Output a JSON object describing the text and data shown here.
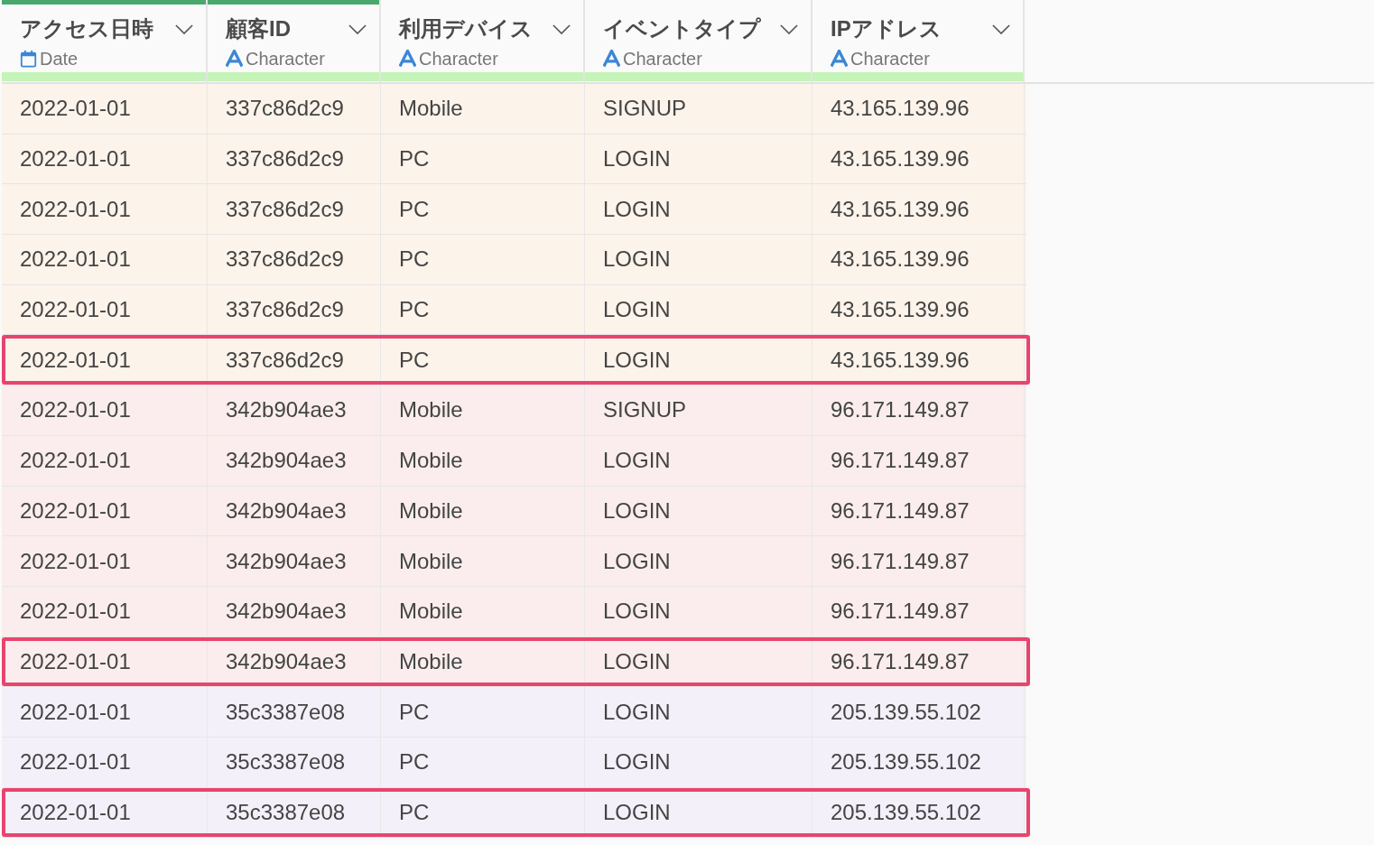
{
  "columns": [
    {
      "title": "アクセス日時",
      "type": "Date",
      "kind": "date",
      "selected": true
    },
    {
      "title": "顧客ID",
      "type": "Character",
      "kind": "character",
      "selected": true
    },
    {
      "title": "利用デバイス",
      "type": "Character",
      "kind": "character",
      "selected": false
    },
    {
      "title": "イベントタイプ",
      "type": "Character",
      "kind": "character",
      "selected": false
    },
    {
      "title": "IPアドレス",
      "type": "Character",
      "kind": "character",
      "selected": false
    }
  ],
  "rows": [
    {
      "color": "#fcf3ea",
      "highlighted": false,
      "cells": [
        "2022-01-01",
        "337c86d2c9",
        "Mobile",
        "SIGNUP",
        "43.165.139.96"
      ]
    },
    {
      "color": "#fcf3ea",
      "highlighted": false,
      "cells": [
        "2022-01-01",
        "337c86d2c9",
        "PC",
        "LOGIN",
        "43.165.139.96"
      ]
    },
    {
      "color": "#fcf3ea",
      "highlighted": false,
      "cells": [
        "2022-01-01",
        "337c86d2c9",
        "PC",
        "LOGIN",
        "43.165.139.96"
      ]
    },
    {
      "color": "#fcf3ea",
      "highlighted": false,
      "cells": [
        "2022-01-01",
        "337c86d2c9",
        "PC",
        "LOGIN",
        "43.165.139.96"
      ]
    },
    {
      "color": "#fcf3ea",
      "highlighted": false,
      "cells": [
        "2022-01-01",
        "337c86d2c9",
        "PC",
        "LOGIN",
        "43.165.139.96"
      ]
    },
    {
      "color": "#fcf3ea",
      "highlighted": true,
      "cells": [
        "2022-01-01",
        "337c86d2c9",
        "PC",
        "LOGIN",
        "43.165.139.96"
      ]
    },
    {
      "color": "#fbeded",
      "highlighted": false,
      "cells": [
        "2022-01-01",
        "342b904ae3",
        "Mobile",
        "SIGNUP",
        "96.171.149.87"
      ]
    },
    {
      "color": "#fbeded",
      "highlighted": false,
      "cells": [
        "2022-01-01",
        "342b904ae3",
        "Mobile",
        "LOGIN",
        "96.171.149.87"
      ]
    },
    {
      "color": "#fbeded",
      "highlighted": false,
      "cells": [
        "2022-01-01",
        "342b904ae3",
        "Mobile",
        "LOGIN",
        "96.171.149.87"
      ]
    },
    {
      "color": "#fbeded",
      "highlighted": false,
      "cells": [
        "2022-01-01",
        "342b904ae3",
        "Mobile",
        "LOGIN",
        "96.171.149.87"
      ]
    },
    {
      "color": "#fbeded",
      "highlighted": false,
      "cells": [
        "2022-01-01",
        "342b904ae3",
        "Mobile",
        "LOGIN",
        "96.171.149.87"
      ]
    },
    {
      "color": "#fbeded",
      "highlighted": true,
      "cells": [
        "2022-01-01",
        "342b904ae3",
        "Mobile",
        "LOGIN",
        "96.171.149.87"
      ]
    },
    {
      "color": "#f4f0f9",
      "highlighted": false,
      "cells": [
        "2022-01-01",
        "35c3387e08",
        "PC",
        "LOGIN",
        "205.139.55.102"
      ]
    },
    {
      "color": "#f4f0f9",
      "highlighted": false,
      "cells": [
        "2022-01-01",
        "35c3387e08",
        "PC",
        "LOGIN",
        "205.139.55.102"
      ]
    },
    {
      "color": "#f4f0f9",
      "highlighted": true,
      "cells": [
        "2022-01-01",
        "35c3387e08",
        "PC",
        "LOGIN",
        "205.139.55.102"
      ]
    }
  ]
}
